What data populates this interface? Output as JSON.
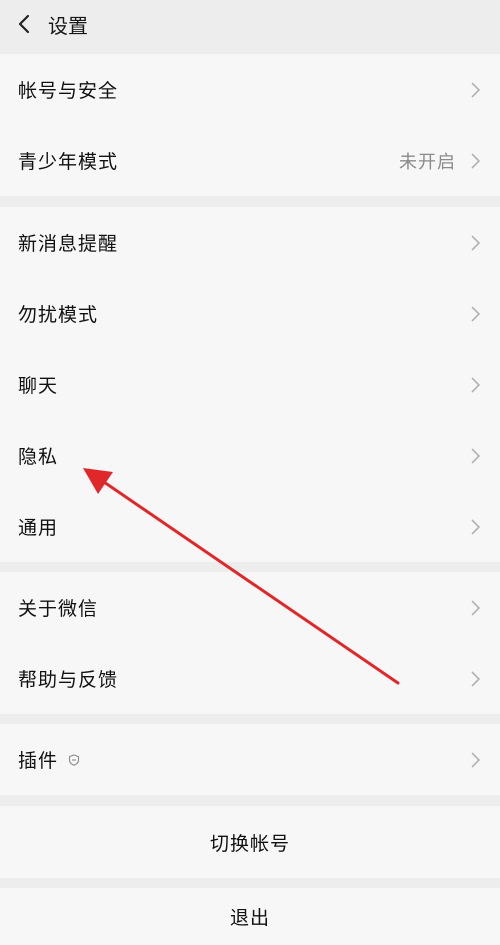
{
  "header": {
    "title": "设置",
    "back_icon": "chevron-left-icon"
  },
  "groups": [
    {
      "items": [
        {
          "label": "帐号与安全"
        },
        {
          "label": "青少年模式",
          "value": "未开启"
        }
      ]
    },
    {
      "items": [
        {
          "label": "新消息提醒"
        },
        {
          "label": "勿扰模式"
        },
        {
          "label": "聊天"
        },
        {
          "label": "隐私"
        },
        {
          "label": "通用"
        }
      ]
    },
    {
      "items": [
        {
          "label": "关于微信"
        },
        {
          "label": "帮助与反馈"
        }
      ]
    },
    {
      "items": [
        {
          "label": "插件",
          "badge_icon": "shield-icon"
        }
      ]
    }
  ],
  "switch_account": {
    "label": "切换帐号"
  },
  "logout": {
    "label": "退出"
  },
  "colors": {
    "background": "#ededed",
    "card": "#f7f7f7",
    "annotation_arrow": "#e0282b"
  }
}
